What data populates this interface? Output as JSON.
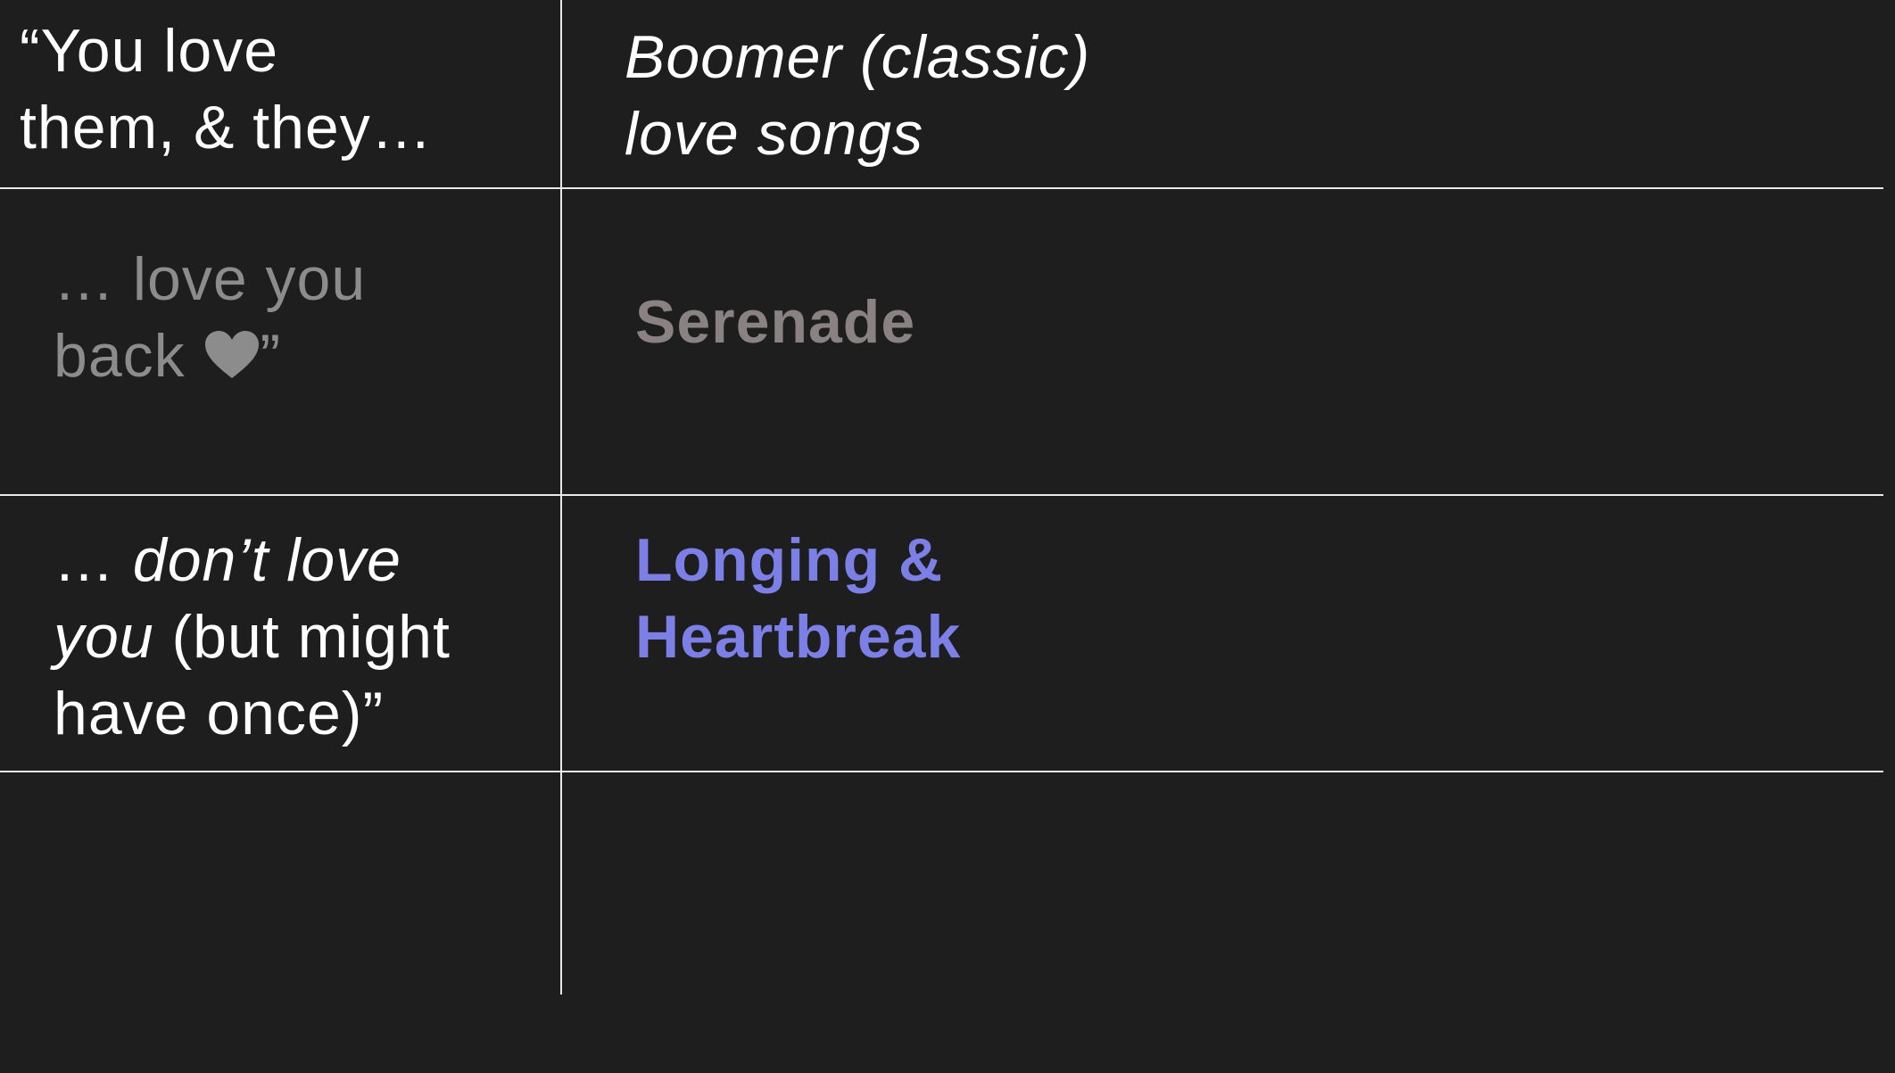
{
  "header": {
    "left_lines": [
      "“You love",
      "them, & they…"
    ],
    "right_lines": [
      "Boomer (classic)",
      "love songs"
    ]
  },
  "rows": [
    {
      "left_line1": "… love you",
      "left_line2_prefix": "back ",
      "left_line2_suffix": "”",
      "left_icon": "heart-icon",
      "right_lines": [
        "Serenade"
      ],
      "left_color": "#8c8c8c",
      "right_color": "#8a8282"
    },
    {
      "left_line1_prefix": "… ",
      "left_line1_em": "don’t love",
      "left_line2_em": "you",
      "left_line2_rest": " (but might",
      "left_line3": "have once)”",
      "right_lines": [
        "Longing &",
        "Heartbreak"
      ],
      "right_color": "#7b7fe6"
    }
  ]
}
